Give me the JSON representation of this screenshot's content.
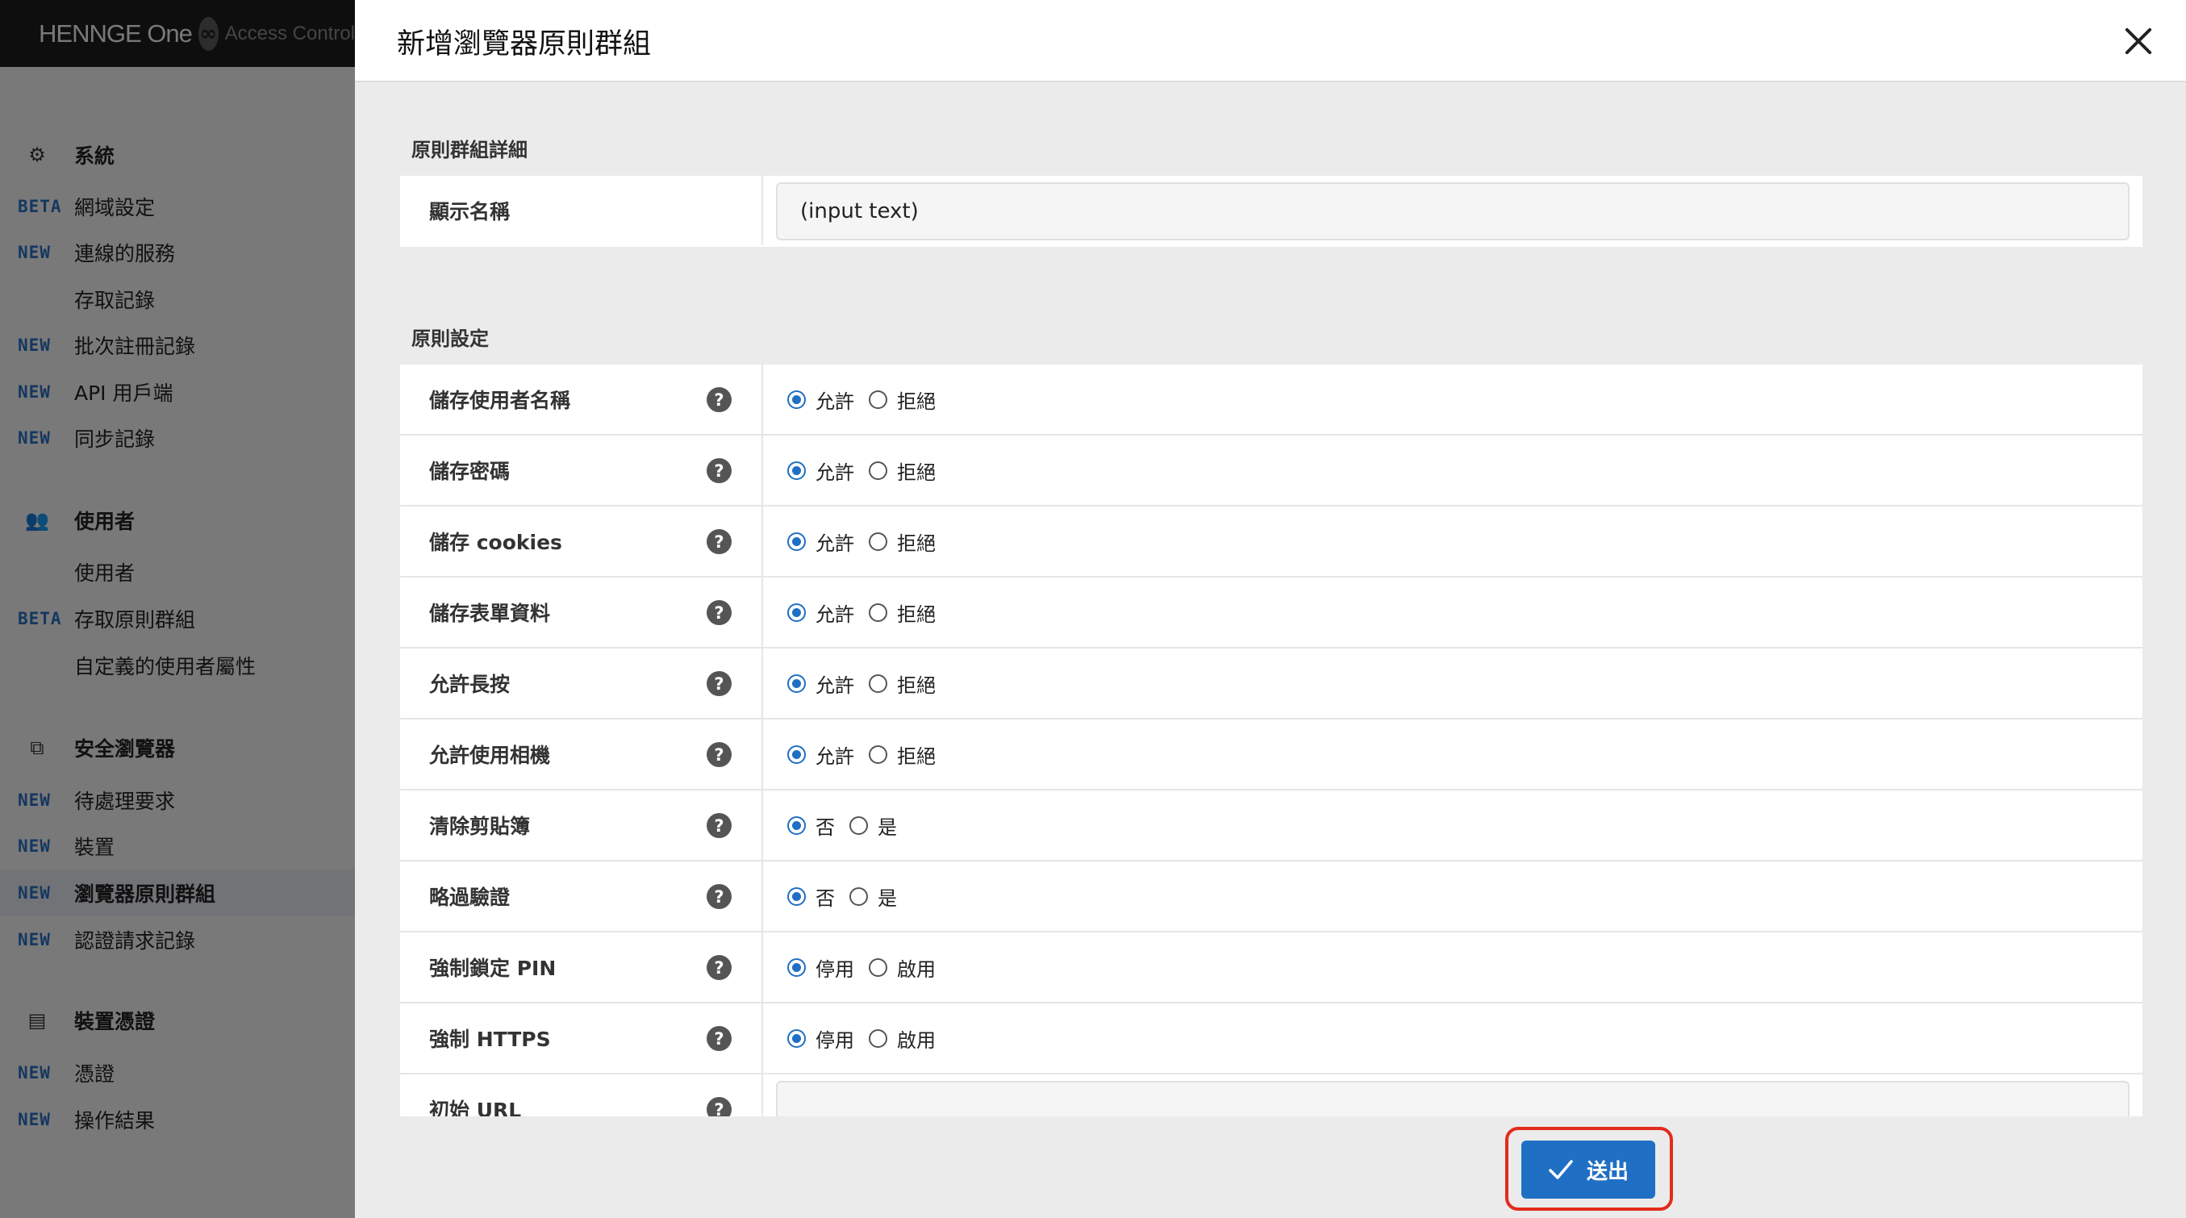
{
  "brand": {
    "name": "HENNGE One",
    "product": "Access Control"
  },
  "sidebar": {
    "sections": [
      {
        "title": "系統",
        "icon": "gear-icon",
        "glyph": "⚙",
        "items": [
          {
            "badge": "BETA",
            "label": "網域設定"
          },
          {
            "badge": "NEW",
            "label": "連線的服務"
          },
          {
            "badge": "",
            "label": "存取記錄"
          },
          {
            "badge": "NEW",
            "label": "批次註冊記錄"
          },
          {
            "badge": "NEW",
            "label": "API 用戶端"
          },
          {
            "badge": "NEW",
            "label": "同步記錄"
          }
        ]
      },
      {
        "title": "使用者",
        "icon": "users-icon",
        "glyph": "👥",
        "items": [
          {
            "badge": "",
            "label": "使用者"
          },
          {
            "badge": "BETA",
            "label": "存取原則群組"
          },
          {
            "badge": "",
            "label": "自定義的使用者屬性"
          }
        ]
      },
      {
        "title": "安全瀏覽器",
        "icon": "browser-icon",
        "glyph": "⧉",
        "items": [
          {
            "badge": "NEW",
            "label": "待處理要求"
          },
          {
            "badge": "NEW",
            "label": "裝置"
          },
          {
            "badge": "NEW",
            "label": "瀏覽器原則群組",
            "active": true
          },
          {
            "badge": "NEW",
            "label": "認證請求記錄"
          }
        ]
      },
      {
        "title": "裝置憑證",
        "icon": "certificate-icon",
        "glyph": "▤",
        "items": [
          {
            "badge": "NEW",
            "label": "憑證"
          },
          {
            "badge": "NEW",
            "label": "操作結果"
          }
        ]
      }
    ]
  },
  "modal": {
    "title": "新增瀏覽器原則群組",
    "details_title": "原則群組詳細",
    "display_name": {
      "label": "顯示名稱",
      "value": "(input text)"
    },
    "settings_title": "原則設定",
    "settings": [
      {
        "key": "save-username",
        "label": "儲存使用者名稱",
        "options": [
          "允許",
          "拒絕"
        ],
        "selected": 0
      },
      {
        "key": "save-password",
        "label": "儲存密碼",
        "options": [
          "允許",
          "拒絕"
        ],
        "selected": 0
      },
      {
        "key": "save-cookies",
        "label": "儲存 cookies",
        "options": [
          "允許",
          "拒絕"
        ],
        "selected": 0
      },
      {
        "key": "save-form-data",
        "label": "儲存表單資料",
        "options": [
          "允許",
          "拒絕"
        ],
        "selected": 0
      },
      {
        "key": "allow-long-press",
        "label": "允許長按",
        "options": [
          "允許",
          "拒絕"
        ],
        "selected": 0
      },
      {
        "key": "allow-camera",
        "label": "允許使用相機",
        "options": [
          "允許",
          "拒絕"
        ],
        "selected": 0
      },
      {
        "key": "clear-clipboard",
        "label": "清除剪貼簿",
        "options": [
          "否",
          "是"
        ],
        "selected": 0
      },
      {
        "key": "skip-auth",
        "label": "略過驗證",
        "options": [
          "否",
          "是"
        ],
        "selected": 0
      },
      {
        "key": "force-pin-lock",
        "label": "強制鎖定 PIN",
        "options": [
          "停用",
          "啟用"
        ],
        "selected": 0
      },
      {
        "key": "force-https",
        "label": "強制 HTTPS",
        "options": [
          "停用",
          "啟用"
        ],
        "selected": 0
      }
    ],
    "start_url": {
      "label": "初始 URL",
      "value": ""
    },
    "submit_label": "送出"
  },
  "colors": {
    "accent": "#1f6fc4",
    "highlight_ring": "#e32b1c"
  }
}
